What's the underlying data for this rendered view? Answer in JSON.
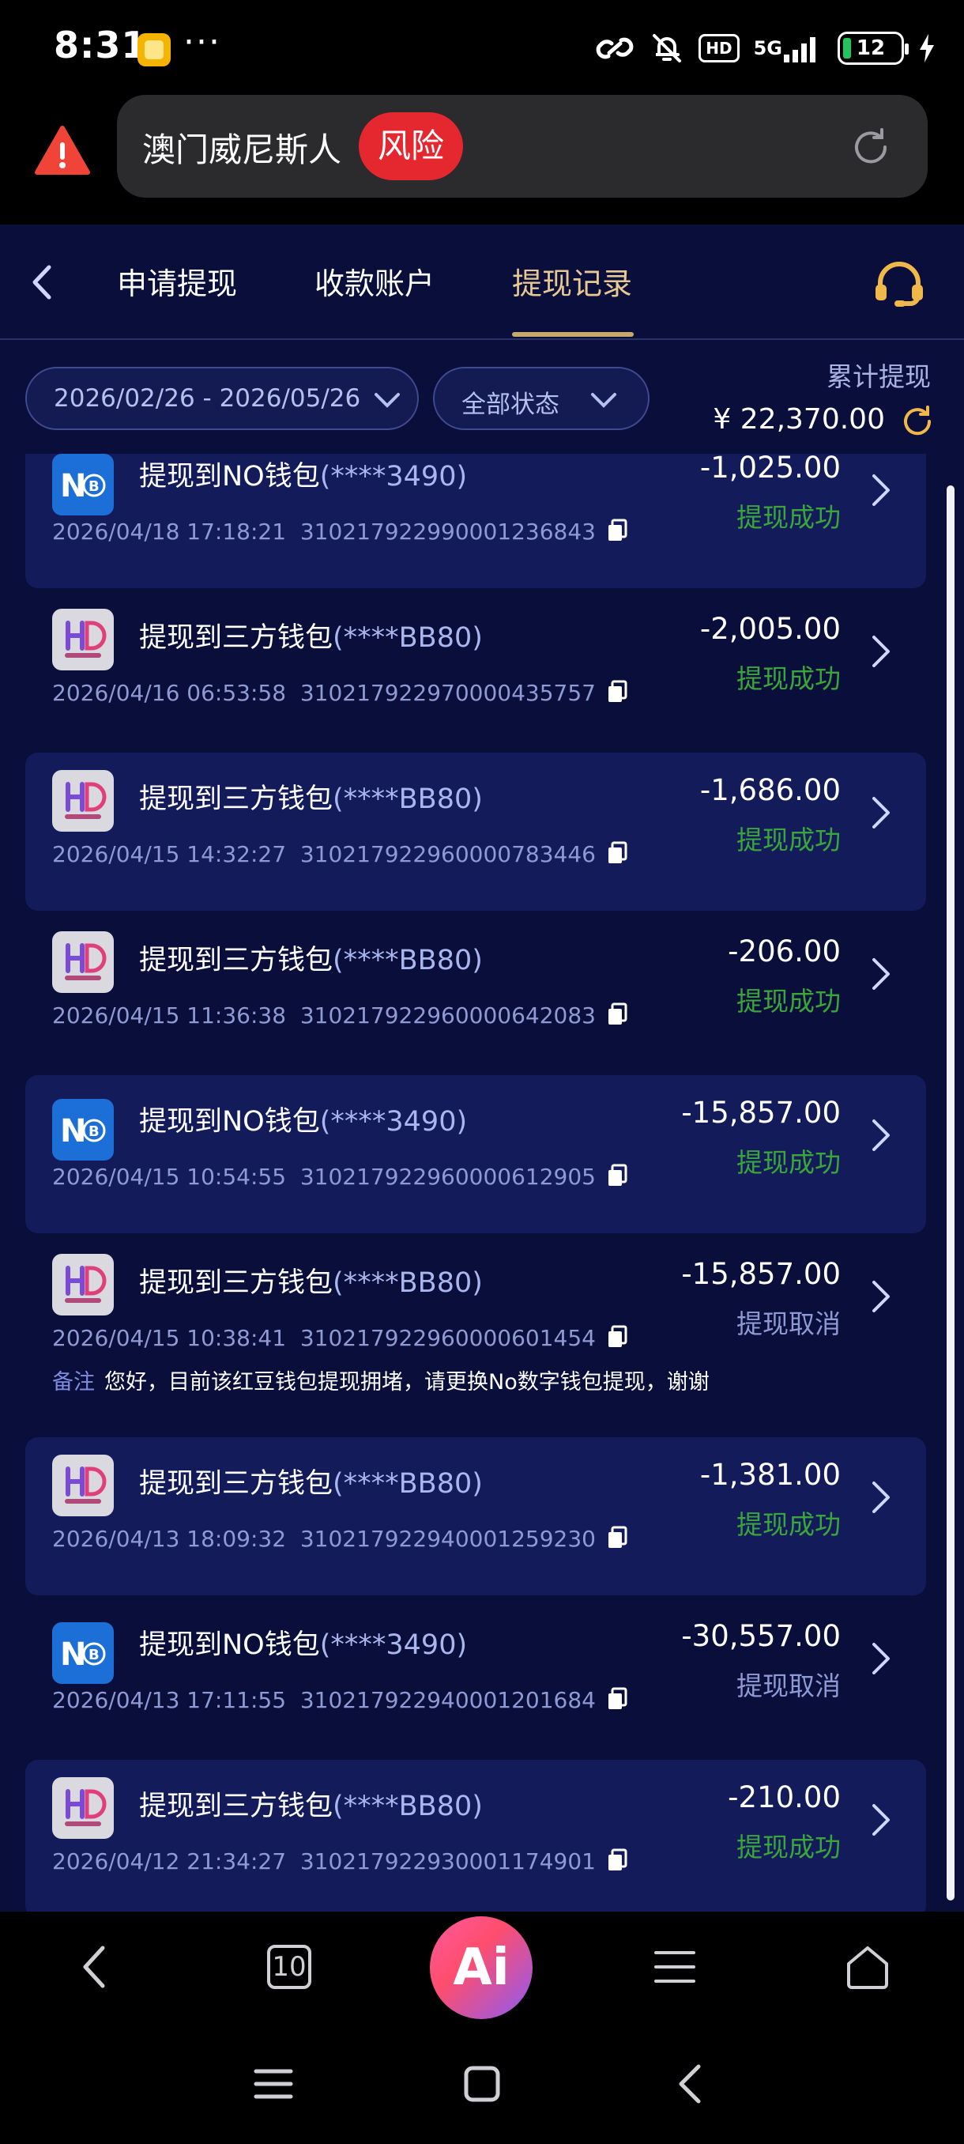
{
  "status_bar": {
    "time": "8:31",
    "dots": "···",
    "hd": "HD",
    "network": "5G",
    "battery": "12"
  },
  "address_bar": {
    "site_title": "澳门威尼斯人",
    "risk_label": "风险"
  },
  "tabs": [
    {
      "label": "申请提现"
    },
    {
      "label": "收款账户"
    },
    {
      "label": "提现记录"
    }
  ],
  "filters": {
    "date_range": "2026/02/26 - 2026/05/26",
    "status": "全部状态"
  },
  "total": {
    "label": "累计提现",
    "value": "¥ 22,370.00"
  },
  "records": [
    {
      "wallet": "NO",
      "title": "提现到NO钱包",
      "mask": "(****3490)",
      "datetime": "2026/04/18 17:18:21",
      "order_no": "310217922990001236843",
      "amount": "-1,025.00",
      "status": "提现成功",
      "status_kind": "ok"
    },
    {
      "wallet": "HD",
      "title": "提现到三方钱包",
      "mask": "(****BB80)",
      "datetime": "2026/04/16 06:53:58",
      "order_no": "310217922970000435757",
      "amount": "-2,005.00",
      "status": "提现成功",
      "status_kind": "ok"
    },
    {
      "wallet": "HD",
      "title": "提现到三方钱包",
      "mask": "(****BB80)",
      "datetime": "2026/04/15 14:32:27",
      "order_no": "310217922960000783446",
      "amount": "-1,686.00",
      "status": "提现成功",
      "status_kind": "ok"
    },
    {
      "wallet": "HD",
      "title": "提现到三方钱包",
      "mask": "(****BB80)",
      "datetime": "2026/04/15 11:36:38",
      "order_no": "310217922960000642083",
      "amount": "-206.00",
      "status": "提现成功",
      "status_kind": "ok"
    },
    {
      "wallet": "NO",
      "title": "提现到NO钱包",
      "mask": "(****3490)",
      "datetime": "2026/04/15 10:54:55",
      "order_no": "310217922960000612905",
      "amount": "-15,857.00",
      "status": "提现成功",
      "status_kind": "ok"
    },
    {
      "wallet": "HD",
      "title": "提现到三方钱包",
      "mask": "(****BB80)",
      "datetime": "2026/04/15 10:38:41",
      "order_no": "310217922960000601454",
      "amount": "-15,857.00",
      "status": "提现取消",
      "status_kind": "cancel",
      "remark_label": "备注",
      "remark": "您好，目前该红豆钱包提现拥堵，请更换No数字钱包提现，谢谢"
    },
    {
      "wallet": "HD",
      "title": "提现到三方钱包",
      "mask": "(****BB80)",
      "datetime": "2026/04/13 18:09:32",
      "order_no": "310217922940001259230",
      "amount": "-1,381.00",
      "status": "提现成功",
      "status_kind": "ok"
    },
    {
      "wallet": "NO",
      "title": "提现到NO钱包",
      "mask": "(****3490)",
      "datetime": "2026/04/13 17:11:55",
      "order_no": "310217922940001201684",
      "amount": "-30,557.00",
      "status": "提现取消",
      "status_kind": "cancel"
    },
    {
      "wallet": "HD",
      "title": "提现到三方钱包",
      "mask": "(****BB80)",
      "datetime": "2026/04/12 21:34:27",
      "order_no": "310217922930001174901",
      "amount": "-210.00",
      "status": "提现成功",
      "status_kind": "ok"
    }
  ],
  "browser_nav": {
    "tab_count": "10",
    "ai_label": "Ai"
  },
  "colors": {
    "page_bg": "#0a0e3a",
    "card_alt": "#141b5a",
    "success": "#3aa63a",
    "cancel": "#8f9ad4",
    "active_tab": "#e7c892",
    "risk": "#e5282f"
  }
}
